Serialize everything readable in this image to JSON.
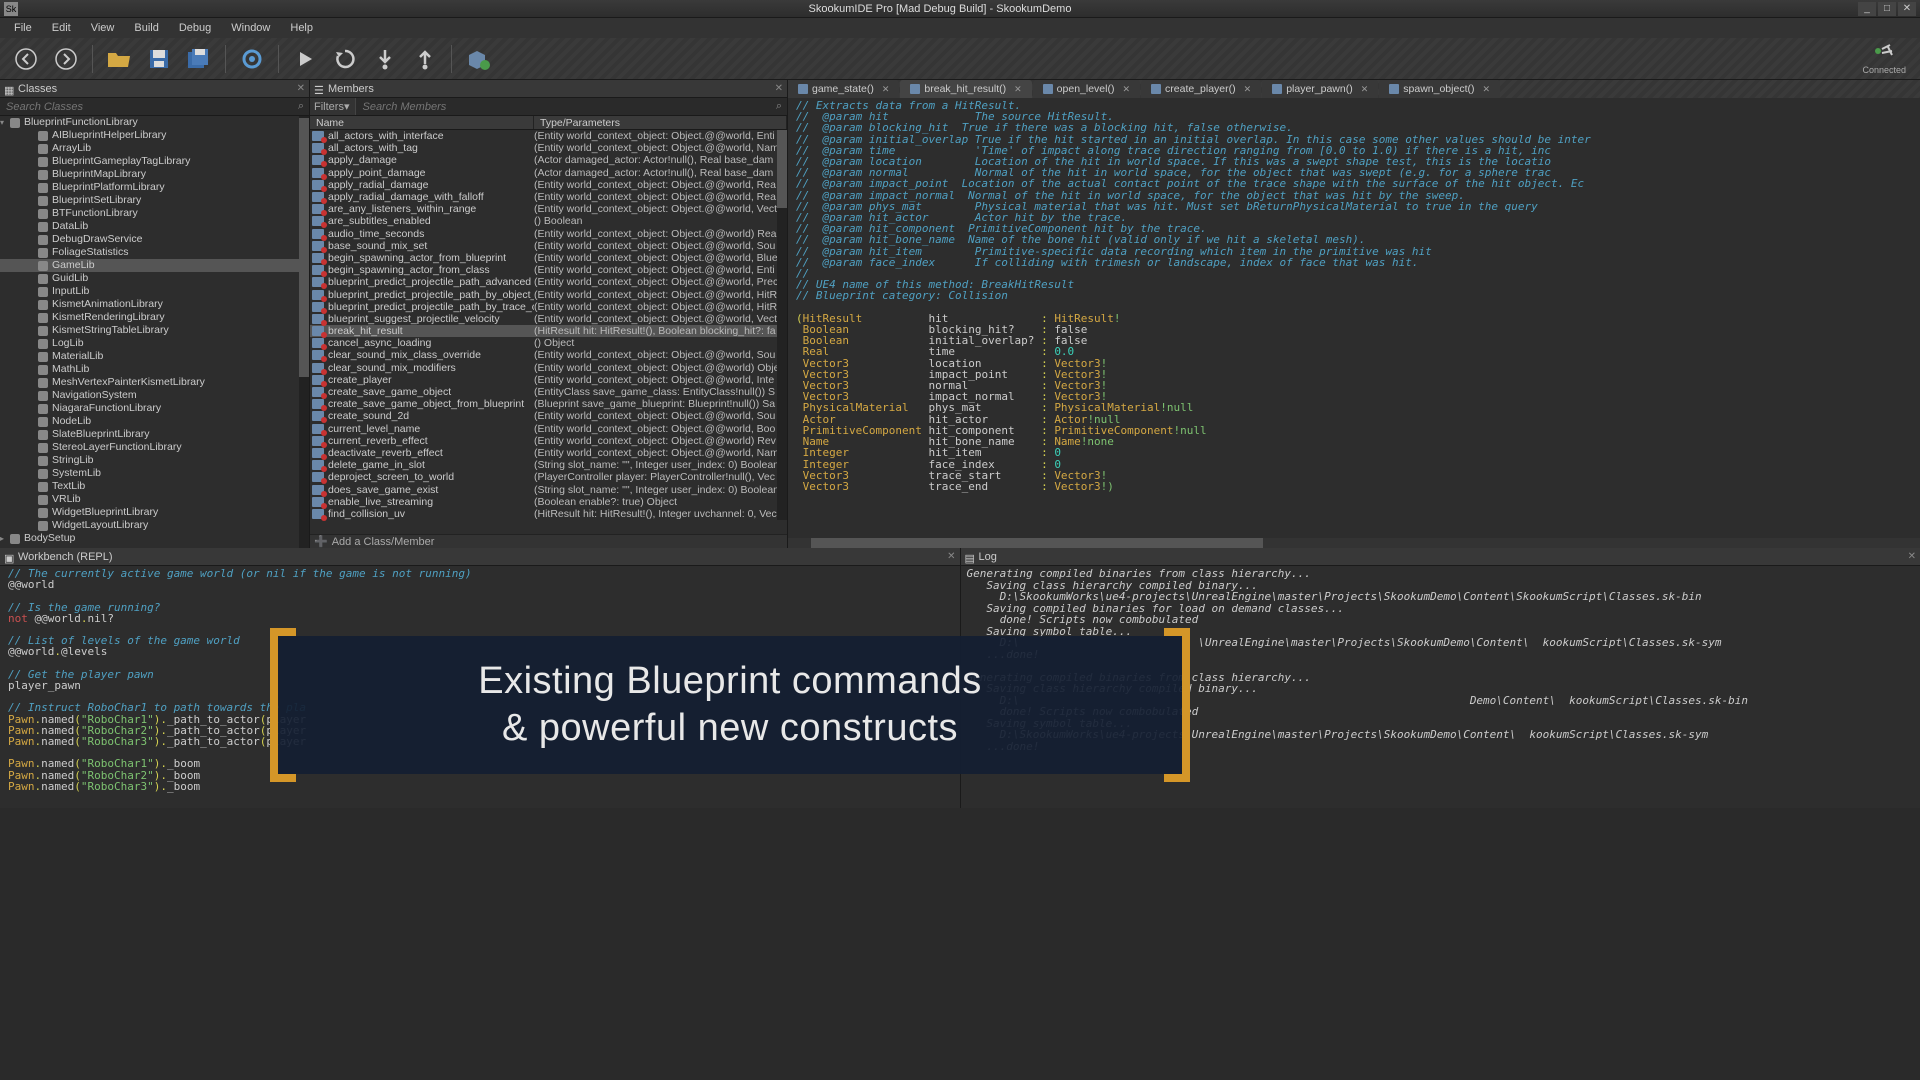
{
  "titlebar": {
    "title": "SkookumIDE Pro [Mad Debug Build] - SkookumDemo"
  },
  "menus": [
    "File",
    "Edit",
    "View",
    "Build",
    "Debug",
    "Window",
    "Help"
  ],
  "connected_label": "Connected",
  "panels": {
    "classes": {
      "title": "Classes",
      "search_placeholder": "Search Classes"
    },
    "members": {
      "title": "Members",
      "filters": "Filters",
      "search_placeholder": "Search Members",
      "col_name": "Name",
      "col_type": "Type/Parameters",
      "add_label": "Add a Class/Member"
    },
    "workbench": {
      "title": "Workbench (REPL)"
    },
    "log": {
      "title": "Log"
    }
  },
  "classes_root": "BlueprintFunctionLibrary",
  "classes": [
    "AIBlueprintHelperLibrary",
    "ArrayLib",
    "BlueprintGameplayTagLibrary",
    "BlueprintMapLibrary",
    "BlueprintPlatformLibrary",
    "BlueprintSetLibrary",
    "BTFunctionLibrary",
    "DataLib",
    "DebugDrawService",
    "FoliageStatistics",
    "GameLib",
    "GuidLib",
    "InputLib",
    "KismetAnimationLibrary",
    "KismetRenderingLibrary",
    "KismetStringTableLibrary",
    "LogLib",
    "MaterialLib",
    "MathLib",
    "MeshVertexPainterKismetLibrary",
    "NavigationSystem",
    "NiagaraFunctionLibrary",
    "NodeLib",
    "SlateBlueprintLibrary",
    "StereoLayerFunctionLibrary",
    "StringLib",
    "SystemLib",
    "TextLib",
    "VRLib",
    "WidgetBlueprintLibrary",
    "WidgetLayoutLibrary"
  ],
  "classes_extra": "BodySetup",
  "classes_selected": "GameLib",
  "members": [
    {
      "n": "all_actors_with_interface",
      "t": "(Entity world_context_object: Object.@@world, Enti"
    },
    {
      "n": "all_actors_with_tag",
      "t": "(Entity world_context_object: Object.@@world, Nam"
    },
    {
      "n": "apply_damage",
      "t": "(Actor damaged_actor: Actor!null(), Real base_dam"
    },
    {
      "n": "apply_point_damage",
      "t": "(Actor damaged_actor: Actor!null(), Real base_dam"
    },
    {
      "n": "apply_radial_damage",
      "t": "(Entity world_context_object: Object.@@world, Rea"
    },
    {
      "n": "apply_radial_damage_with_falloff",
      "t": "(Entity world_context_object: Object.@@world, Rea"
    },
    {
      "n": "are_any_listeners_within_range",
      "t": "(Entity world_context_object: Object.@@world, Vect"
    },
    {
      "n": "are_subtitles_enabled",
      "t": "() Boolean"
    },
    {
      "n": "audio_time_seconds",
      "t": "(Entity world_context_object: Object.@@world) Rea"
    },
    {
      "n": "base_sound_mix_set",
      "t": "(Entity world_context_object: Object.@@world, Sou"
    },
    {
      "n": "begin_spawning_actor_from_blueprint",
      "t": "(Entity world_context_object: Object.@@world, Blue"
    },
    {
      "n": "begin_spawning_actor_from_class",
      "t": "(Entity world_context_object: Object.@@world, Enti"
    },
    {
      "n": "blueprint_predict_projectile_path_advanced",
      "t": "(Entity world_context_object: Object.@@world, Prec"
    },
    {
      "n": "blueprint_predict_projectile_path_by_object_type",
      "t": "(Entity world_context_object: Object.@@world, HitR"
    },
    {
      "n": "blueprint_predict_projectile_path_by_trace_channel",
      "t": "(Entity world_context_object: Object.@@world, HitR"
    },
    {
      "n": "blueprint_suggest_projectile_velocity",
      "t": "(Entity world_context_object: Object.@@world, Vecto"
    },
    {
      "n": "break_hit_result",
      "t": "(HitResult hit: HitResult!(), Boolean blocking_hit?: fa"
    },
    {
      "n": "cancel_async_loading",
      "t": "() Object"
    },
    {
      "n": "clear_sound_mix_class_override",
      "t": "(Entity world_context_object: Object.@@world, Sou"
    },
    {
      "n": "clear_sound_mix_modifiers",
      "t": "(Entity world_context_object: Object.@@world) Obje"
    },
    {
      "n": "create_player",
      "t": "(Entity world_context_object: Object.@@world, Inte"
    },
    {
      "n": "create_save_game_object",
      "t": "(EntityClass save_game_class: EntityClass!null()) S"
    },
    {
      "n": "create_save_game_object_from_blueprint",
      "t": "(Blueprint save_game_blueprint: Blueprint!null()) Sa"
    },
    {
      "n": "create_sound_2d",
      "t": "(Entity world_context_object: Object.@@world, Sou"
    },
    {
      "n": "current_level_name",
      "t": "(Entity world_context_object: Object.@@world, Boo"
    },
    {
      "n": "current_reverb_effect",
      "t": "(Entity world_context_object: Object.@@world) Rev"
    },
    {
      "n": "deactivate_reverb_effect",
      "t": "(Entity world_context_object: Object.@@world, Nam"
    },
    {
      "n": "delete_game_in_slot",
      "t": "(String slot_name: \"\", Integer user_index: 0) Boolean"
    },
    {
      "n": "deproject_screen_to_world",
      "t": "(PlayerController player: PlayerController!null(), Vec"
    },
    {
      "n": "does_save_game_exist",
      "t": "(String slot_name: \"\", Integer user_index: 0) Boolean"
    },
    {
      "n": "enable_live_streaming",
      "t": "(Boolean enable?: true) Object"
    },
    {
      "n": "find_collision_uv",
      "t": "(HitResult hit: HitResult!(), Integer uvchannel: 0, Vec"
    }
  ],
  "members_selected": "break_hit_result",
  "editor_tabs": [
    "game_state()",
    "break_hit_result()",
    "open_level()",
    "create_player()",
    "player_pawn()",
    "spawn_object()"
  ],
  "editor_active_tab": 1,
  "code_comments": [
    "// Extracts data from a HitResult.",
    "//  @param hit             The source HitResult.",
    "//  @param blocking_hit  True if there was a blocking hit, false otherwise.",
    "//  @param initial_overlap True if the hit started in an initial overlap. In this case some other values should be inter",
    "//  @param time            'Time' of impact along trace direction ranging from [0.0 to 1.0) if there is a hit, inc",
    "//  @param location        Location of the hit in world space. If this was a swept shape test, this is the locatio",
    "//  @param normal          Normal of the hit in world space, for the object that was swept (e.g. for a sphere trac",
    "//  @param impact_point  Location of the actual contact point of the trace shape with the surface of the hit object. Ec",
    "//  @param impact_normal  Normal of the hit in world space, for the object that was hit by the sweep.",
    "//  @param phys_mat        Physical material that was hit. Must set bReturnPhysicalMaterial to true in the query",
    "//  @param hit_actor       Actor hit by the trace.",
    "//  @param hit_component  PrimitiveComponent hit by the trace.",
    "//  @param hit_bone_name  Name of the bone hit (valid only if we hit a skeletal mesh).",
    "//  @param hit_item        Primitive-specific data recording which item in the primitive was hit",
    "//  @param face_index      If colliding with trimesh or landscape, index of face that was hit.",
    "//",
    "// UE4 name of this method: BreakHitResult",
    "// Blueprint category: Collision"
  ],
  "code_params": [
    {
      "type": "HitResult",
      "name": "hit",
      "val": "HitResult",
      "suf": "!",
      "vc": "type"
    },
    {
      "type": "Boolean",
      "name": "blocking_hit?",
      "val": "false",
      "vc": "lit"
    },
    {
      "type": "Boolean",
      "name": "initial_overlap?",
      "val": "false",
      "vc": "lit"
    },
    {
      "type": "Real",
      "name": "time",
      "val": "0.0",
      "vc": "num"
    },
    {
      "type": "Vector3",
      "name": "location",
      "val": "Vector3",
      "suf": "!",
      "vc": "type"
    },
    {
      "type": "Vector3",
      "name": "impact_point",
      "val": "Vector3",
      "suf": "!",
      "vc": "type"
    },
    {
      "type": "Vector3",
      "name": "normal",
      "val": "Vector3",
      "suf": "!",
      "vc": "type"
    },
    {
      "type": "Vector3",
      "name": "impact_normal",
      "val": "Vector3",
      "suf": "!",
      "vc": "type"
    },
    {
      "type": "PhysicalMaterial",
      "name": "phys_mat",
      "val": "PhysicalMaterial",
      "suf": "!null",
      "vc": "type"
    },
    {
      "type": "Actor",
      "name": "hit_actor",
      "val": "Actor",
      "suf": "!null",
      "vc": "type"
    },
    {
      "type": "PrimitiveComponent",
      "name": "hit_component",
      "val": "PrimitiveComponent",
      "suf": "!null",
      "vc": "type"
    },
    {
      "type": "Name",
      "name": "hit_bone_name",
      "val": "Name",
      "suf": "!none",
      "vc": "type"
    },
    {
      "type": "Integer",
      "name": "hit_item",
      "val": "0",
      "vc": "num"
    },
    {
      "type": "Integer",
      "name": "face_index",
      "val": "0",
      "vc": "num"
    },
    {
      "type": "Vector3",
      "name": "trace_start",
      "val": "Vector3",
      "suf": "!",
      "vc": "type"
    },
    {
      "type": "Vector3",
      "name": "trace_end",
      "val": "Vector3",
      "suf": "!)",
      "vc": "type",
      "last": true
    }
  ],
  "workbench_lines": [
    {
      "kind": "comment",
      "text": "// The currently active game world (or nil if the game is not running)"
    },
    {
      "kind": "plain",
      "text": "@@world"
    },
    {
      "kind": "blank"
    },
    {
      "kind": "comment",
      "text": "// Is the game running?"
    },
    {
      "kind": "mixed",
      "parts": [
        {
          "c": "red",
          "t": "not"
        },
        {
          "c": "plain",
          "t": " @@world"
        },
        {
          "c": "YW",
          "t": "."
        },
        {
          "c": "plain",
          "t": "nil?"
        }
      ]
    },
    {
      "kind": "blank"
    },
    {
      "kind": "comment",
      "text": "// List of levels of the game world"
    },
    {
      "kind": "mixed",
      "parts": [
        {
          "c": "plain",
          "t": "@@world"
        },
        {
          "c": "YW",
          "t": "."
        },
        {
          "c": "plain",
          "t": "@levels"
        }
      ]
    },
    {
      "kind": "blank"
    },
    {
      "kind": "comment",
      "text": "// Get the player pawn"
    },
    {
      "kind": "plain",
      "text": "player_pawn"
    },
    {
      "kind": "blank"
    },
    {
      "kind": "comment",
      "text": "// Instruct RoboChar1 to path towards the pla"
    },
    {
      "kind": "pawn",
      "robo": "RoboChar1",
      "method": "_path_to_actor",
      "arg": "player"
    },
    {
      "kind": "pawn",
      "robo": "RoboChar2",
      "method": "_path_to_actor",
      "arg": "player"
    },
    {
      "kind": "pawn",
      "robo": "RoboChar3",
      "method": "_path_to_actor",
      "arg": "player"
    },
    {
      "kind": "blank"
    },
    {
      "kind": "boom",
      "robo": "RoboChar1"
    },
    {
      "kind": "boom",
      "robo": "RoboChar2"
    },
    {
      "kind": "boom",
      "robo": "RoboChar3"
    }
  ],
  "log_lines": [
    "Generating compiled binaries from class hierarchy...",
    "   Saving class hierarchy compiled binary...",
    "     D:\\SkookumWorks\\ue4-projects\\UnrealEngine\\master\\Projects\\SkookumDemo\\Content\\SkookumScript\\Classes.sk-bin",
    "   Saving compiled binaries for load on demand classes...",
    "     done! Scripts now combobulated",
    "   Saving symbol table...",
    "     D:\\                           \\UnrealEngine\\master\\Projects\\SkookumDemo\\Content\\  kookumScript\\Classes.sk-sym",
    "   ...done!",
    "",
    "Generating compiled binaries from class hierarchy...",
    "   Saving class hierarchy compiled binary...",
    "     D:\\                                                                    Demo\\Content\\  kookumScript\\Classes.sk-bin",
    "     done! Scripts now combobulated",
    "   Saving symbol table...",
    "     D:\\SkookumWorks\\ue4-projects\\UnrealEngine\\master\\Projects\\SkookumDemo\\Content\\  kookumScript\\Classes.sk-sym",
    "   ...done!"
  ],
  "overlay": {
    "line1": "Existing Blueprint commands",
    "line2": "& powerful new constructs"
  }
}
